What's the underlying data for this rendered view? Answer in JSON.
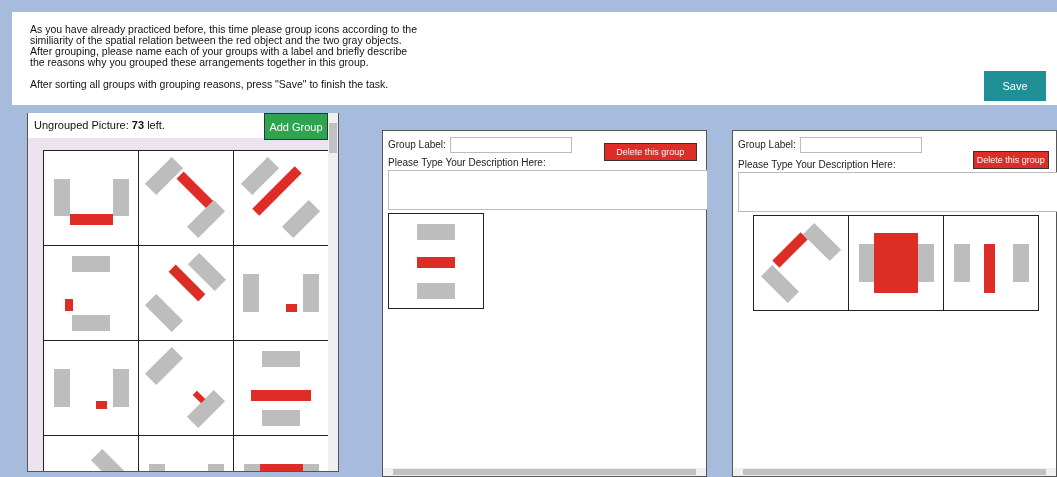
{
  "instructions": "As you have already practiced before, this time please group icons according to the\nsimiliarity of the spatial relation between the red object and the two gray objects.\nAfter grouping, please name each of your groups with a label and briefly describe\nthe reasons why you grouped these arrangements together in this group.\n\nAfter sorting all groups with grouping reasons, press \"Save\" to finish the task.",
  "save_button": "Save",
  "ungrouped": {
    "header": "Ungrouped Picture: **73** left.",
    "add_button": "Add Group"
  },
  "groups": [
    {
      "label_caption": "Group Label:",
      "delete_button": "Delete this group",
      "description_caption": "Please Type Your Description Here:"
    },
    {
      "label_caption": "Group Label:",
      "delete_button": "Delete this group",
      "description_caption": "Please Type Your Description Here:"
    }
  ]
}
